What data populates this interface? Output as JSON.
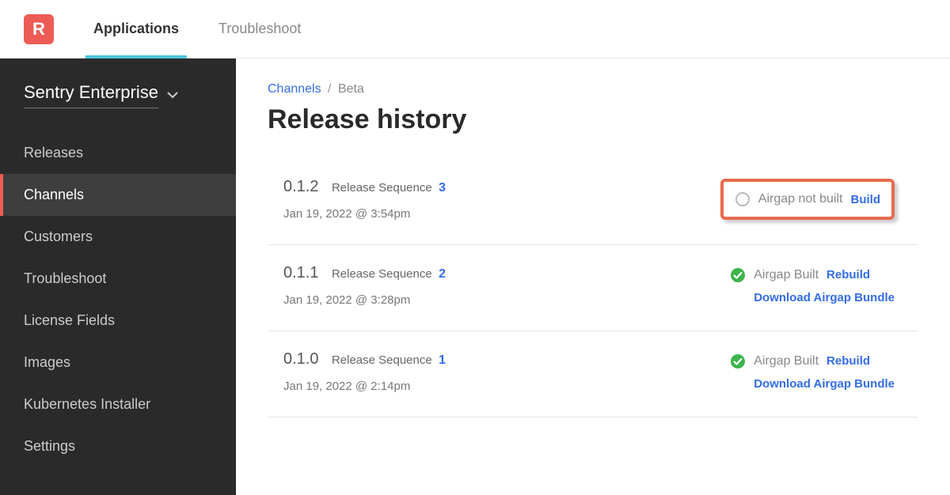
{
  "topnav": {
    "logo": "R",
    "items": [
      {
        "label": "Applications",
        "active": true
      },
      {
        "label": "Troubleshoot",
        "active": false
      }
    ]
  },
  "sidebar": {
    "project": "Sentry Enterprise",
    "items": [
      {
        "label": "Releases",
        "active": false
      },
      {
        "label": "Channels",
        "active": true
      },
      {
        "label": "Customers",
        "active": false
      },
      {
        "label": "Troubleshoot",
        "active": false
      },
      {
        "label": "License Fields",
        "active": false
      },
      {
        "label": "Images",
        "active": false
      },
      {
        "label": "Kubernetes Installer",
        "active": false
      },
      {
        "label": "Settings",
        "active": false
      }
    ]
  },
  "breadcrumb": {
    "root": "Channels",
    "current": "Beta"
  },
  "page_title": "Release history",
  "releases": [
    {
      "version": "0.1.2",
      "seq_label": "Release Sequence",
      "seq": "3",
      "date": "Jan 19, 2022 @ 3:54pm",
      "airgap_status": "not_built",
      "airgap_text": "Airgap not built",
      "action": "Build",
      "highlight": true
    },
    {
      "version": "0.1.1",
      "seq_label": "Release Sequence",
      "seq": "2",
      "date": "Jan 19, 2022 @ 3:28pm",
      "airgap_status": "built",
      "airgap_text": "Airgap Built",
      "action": "Rebuild",
      "download": "Download Airgap Bundle"
    },
    {
      "version": "0.1.0",
      "seq_label": "Release Sequence",
      "seq": "1",
      "date": "Jan 19, 2022 @ 2:14pm",
      "airgap_status": "built",
      "airgap_text": "Airgap Built",
      "action": "Rebuild",
      "download": "Download Airgap Bundle"
    }
  ]
}
